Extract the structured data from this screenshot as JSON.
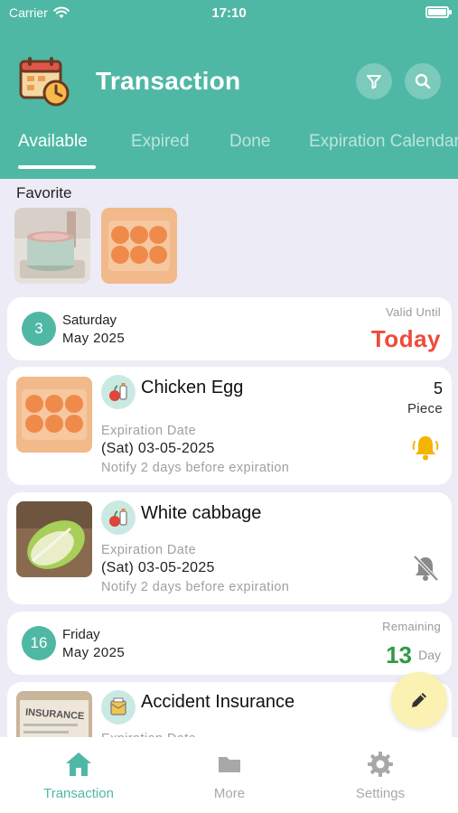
{
  "status_bar": {
    "carrier": "Carrier",
    "time": "17:10"
  },
  "header": {
    "title": "Transaction"
  },
  "tabs": [
    {
      "label": "Available"
    },
    {
      "label": "Expired"
    },
    {
      "label": "Done"
    },
    {
      "label": "Expiration Calendar"
    }
  ],
  "favorite": {
    "title": "Favorite"
  },
  "groups": [
    {
      "day_number": "3",
      "weekday": "Saturday",
      "month_year": "May 2025",
      "status_label": "Valid Until",
      "status_value": "Today"
    },
    {
      "day_number": "16",
      "weekday": "Friday",
      "month_year": "May 2025",
      "status_label": "Remaining",
      "remaining_number": "13",
      "remaining_unit": "Day"
    }
  ],
  "items": [
    {
      "name": "Chicken Egg",
      "expiration_label": "Expiration Date",
      "expiration_date": "(Sat) 03-05-2025",
      "notify": "Notify 2 days before expiration",
      "quantity": "5",
      "unit": "Piece",
      "bell": "bell-active-icon"
    },
    {
      "name": "White cabbage",
      "expiration_label": "Expiration Date",
      "expiration_date": "(Sat) 03-05-2025",
      "notify": "Notify 2 days before expiration",
      "bell": "bell-off-icon"
    },
    {
      "name": "Accident Insurance",
      "expiration_label": "Expiration Date",
      "thumb_text": "INSURANCE"
    }
  ],
  "nav": [
    {
      "label": "Transaction"
    },
    {
      "label": "More"
    },
    {
      "label": "Settings"
    }
  ],
  "colors": {
    "primary": "#4fb8a4",
    "today": "#ef4a3b",
    "remaining": "#2e9b46",
    "fab": "#fbf1b3",
    "bell_active": "#f5b400"
  }
}
